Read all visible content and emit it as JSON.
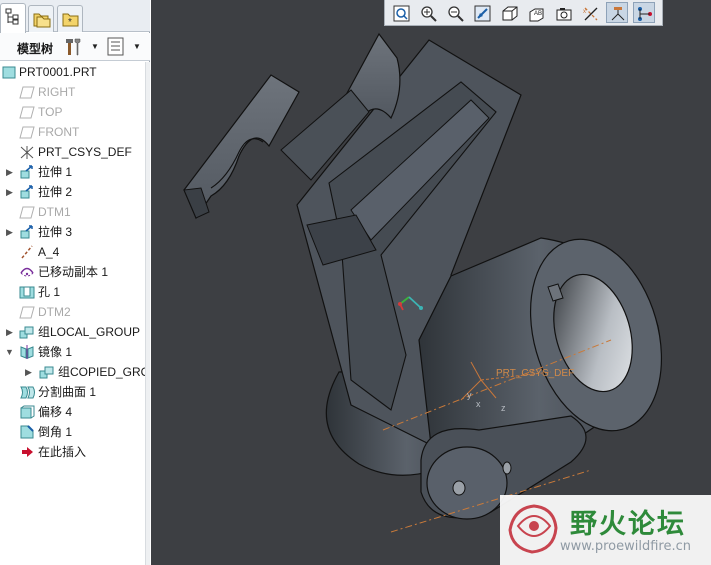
{
  "panel": {
    "tabs": [
      {
        "name": "model-tree-tab-icon"
      },
      {
        "name": "folder-browser-tab-icon"
      },
      {
        "name": "favorites-tab-icon"
      }
    ],
    "toolbar": {
      "title": "模型树",
      "settings_icon": "hammer-wrench-icon",
      "show_icon": "list-icon"
    }
  },
  "tree": {
    "items": [
      {
        "label": "PRT0001.PRT",
        "icon": "part-icon",
        "expander": "",
        "dim": false
      },
      {
        "label": "RIGHT",
        "icon": "datum-plane-icon",
        "expander": "",
        "dim": true
      },
      {
        "label": "TOP",
        "icon": "datum-plane-icon",
        "expander": "",
        "dim": true
      },
      {
        "label": "FRONT",
        "icon": "datum-plane-icon",
        "expander": "",
        "dim": true
      },
      {
        "label": "PRT_CSYS_DEF",
        "icon": "csys-icon",
        "expander": "",
        "dim": false
      },
      {
        "label": "拉伸 1",
        "icon": "extrude-icon",
        "expander": "▶",
        "dim": false
      },
      {
        "label": "拉伸 2",
        "icon": "extrude-icon",
        "expander": "▶",
        "dim": false
      },
      {
        "label": "DTM1",
        "icon": "datum-plane-icon",
        "expander": "",
        "dim": true
      },
      {
        "label": "拉伸 3",
        "icon": "extrude-icon",
        "expander": "▶",
        "dim": false
      },
      {
        "label": "A_4",
        "icon": "axis-icon",
        "expander": "",
        "dim": false
      },
      {
        "label": "已移动副本 1",
        "icon": "moved-copy-icon",
        "expander": "",
        "dim": false
      },
      {
        "label": "孔 1",
        "icon": "hole-icon",
        "expander": "",
        "dim": false
      },
      {
        "label": "DTM2",
        "icon": "datum-plane-icon",
        "expander": "",
        "dim": true
      },
      {
        "label": "组LOCAL_GROUP",
        "icon": "group-icon",
        "expander": "▶",
        "dim": false
      },
      {
        "label": "镜像 1",
        "icon": "mirror-icon",
        "expander": "▼",
        "dim": false
      },
      {
        "label": "组COPIED_GROUP",
        "icon": "group-icon",
        "expander": "▶",
        "dim": false
      },
      {
        "label": "分割曲面 1",
        "icon": "split-surface-icon",
        "expander": "",
        "dim": false
      },
      {
        "label": "偏移 4",
        "icon": "offset-icon",
        "expander": "",
        "dim": false
      },
      {
        "label": "倒角 1",
        "icon": "chamfer-icon",
        "expander": "",
        "dim": false
      },
      {
        "label": "在此插入",
        "icon": "insert-here-icon",
        "expander": "",
        "dim": false
      }
    ]
  },
  "view_toolbar": {
    "buttons": [
      {
        "name": "refit-icon"
      },
      {
        "name": "zoom-in-icon"
      },
      {
        "name": "zoom-out-icon"
      },
      {
        "name": "repaint-icon"
      },
      {
        "name": "display-style-icon"
      },
      {
        "name": "saved-views-icon"
      },
      {
        "name": "view-manager-icon"
      },
      {
        "name": "datum-display-icon"
      },
      {
        "name": "csys-display-icon"
      },
      {
        "name": "annotation-display-icon"
      }
    ]
  },
  "viewport": {
    "csys_label": "PRT_CSYS_DEF",
    "axis_labels": {
      "x": "x",
      "y": "y",
      "z": "z"
    },
    "background": "#3d3f43",
    "part_color": "#4a5058"
  },
  "watermark": {
    "title": "野火论坛",
    "url": "www.proewildfire.cn"
  }
}
